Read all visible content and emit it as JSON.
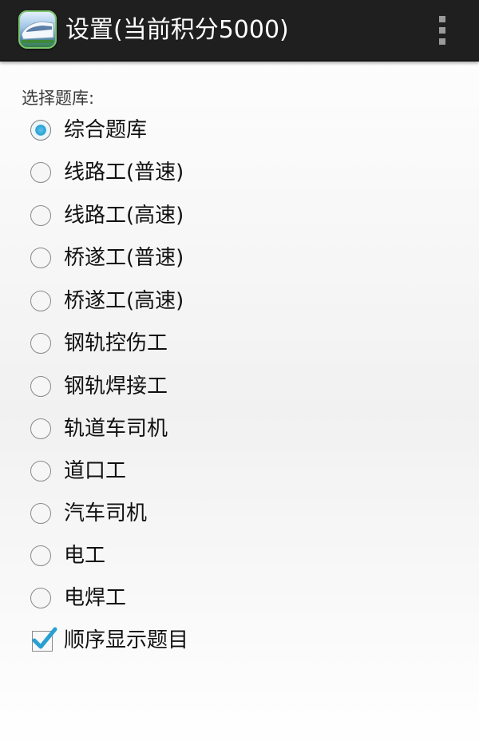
{
  "action_bar": {
    "icon": "train-app-icon",
    "title": "设置(当前积分5000)",
    "overflow_icon": "overflow-menu-icon"
  },
  "settings": {
    "section_label": "选择题库:",
    "selected": "综合题库",
    "options": [
      {
        "label": "综合题库",
        "checked": true
      },
      {
        "label": "线路工(普速)",
        "checked": false
      },
      {
        "label": "线路工(高速)",
        "checked": false
      },
      {
        "label": "桥遂工(普速)",
        "checked": false
      },
      {
        "label": "桥遂工(高速)",
        "checked": false
      },
      {
        "label": "钢轨控伤工",
        "checked": false
      },
      {
        "label": "钢轨焊接工",
        "checked": false
      },
      {
        "label": "轨道车司机",
        "checked": false
      },
      {
        "label": "道口工",
        "checked": false
      },
      {
        "label": "汽车司机",
        "checked": false
      },
      {
        "label": "电工",
        "checked": false
      },
      {
        "label": "电焊工",
        "checked": false
      }
    ],
    "sequential": {
      "label": "顺序显示题目",
      "checked": true
    }
  },
  "colors": {
    "action_bar": "#1f1f1f",
    "accent_blue": "#2aa0d2"
  }
}
